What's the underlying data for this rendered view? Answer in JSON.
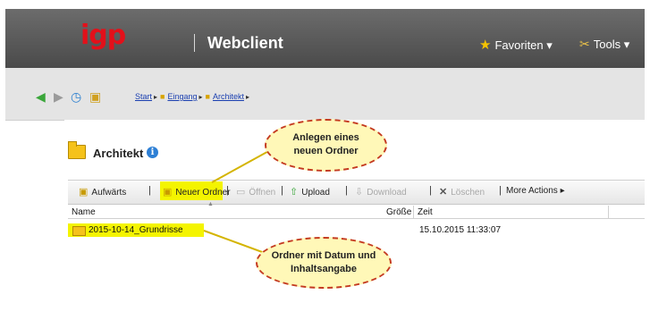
{
  "header": {
    "logo_text": "igp",
    "app_title": "Webclient",
    "favorites_label": "Favoriten ▾",
    "tools_label": "Tools ▾"
  },
  "breadcrumb": {
    "items": [
      "Start",
      "Eingang",
      "Architekt"
    ]
  },
  "folder": {
    "title": "Architekt"
  },
  "toolbar": {
    "up_label": "Aufwärts",
    "new_folder_label": "Neuer Ordner",
    "open_label": "Öffnen",
    "upload_label": "Upload",
    "download_label": "Download",
    "delete_label": "Löschen",
    "more_label": "More Actions"
  },
  "columns": {
    "name": "Name",
    "size": "Größe",
    "time": "Zeit"
  },
  "rows": [
    {
      "name": "2015-10-14_Grundrisse",
      "time": "15.10.2015 11:33:07"
    }
  ],
  "callouts": {
    "new_folder_note": "Anlegen eines neuen Ordner",
    "folder_note": "Ordner mit Datum und Inhaltsangabe"
  },
  "colors": {
    "accent_red": "#e3101a",
    "highlight": "#f4f400",
    "callout_border": "#c43a20"
  }
}
